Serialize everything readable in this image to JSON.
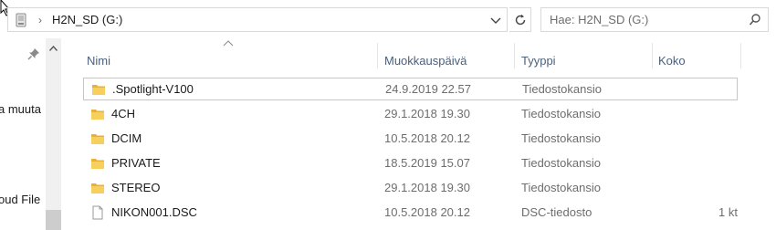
{
  "address_bar": {
    "path": "H2N_SD (G:)",
    "drive_icon": "drive-icon",
    "separator_icon": "chevron-right-icon",
    "dropdown_icon": "chevron-down-icon",
    "refresh_icon": "refresh-icon"
  },
  "search": {
    "placeholder": "Hae: H2N_SD (G:)",
    "icon": "search-icon"
  },
  "nav_pane": {
    "pin_icon": "pin-icon",
    "items": [
      {
        "label": "a muuta"
      },
      {
        "label": "oud File"
      }
    ]
  },
  "columns": {
    "name": "Nimi",
    "modified": "Muokkauspäivä",
    "type": "Tyyppi",
    "size": "Koko"
  },
  "files": [
    {
      "name": ".Spotlight-V100",
      "modified": "24.9.2019 22.57",
      "type": "Tiedostokansio",
      "size": "",
      "icon": "folder-icon",
      "selected": true
    },
    {
      "name": "4CH",
      "modified": "29.1.2018 19.30",
      "type": "Tiedostokansio",
      "size": "",
      "icon": "folder-icon",
      "selected": false
    },
    {
      "name": "DCIM",
      "modified": "10.5.2018 20.12",
      "type": "Tiedostokansio",
      "size": "",
      "icon": "folder-icon",
      "selected": false
    },
    {
      "name": "PRIVATE",
      "modified": "18.5.2019 15.07",
      "type": "Tiedostokansio",
      "size": "",
      "icon": "folder-icon",
      "selected": false
    },
    {
      "name": "STEREO",
      "modified": "29.1.2018 19.30",
      "type": "Tiedostokansio",
      "size": "",
      "icon": "folder-icon",
      "selected": false
    },
    {
      "name": "NIKON001.DSC",
      "modified": "10.5.2018 20.12",
      "type": "DSC-tiedosto",
      "size": "1 kt",
      "icon": "file-icon",
      "selected": false
    }
  ],
  "colors": {
    "selection_border": "#99d1ff",
    "folder": "#f0c14b",
    "header_text": "#4c607a"
  }
}
